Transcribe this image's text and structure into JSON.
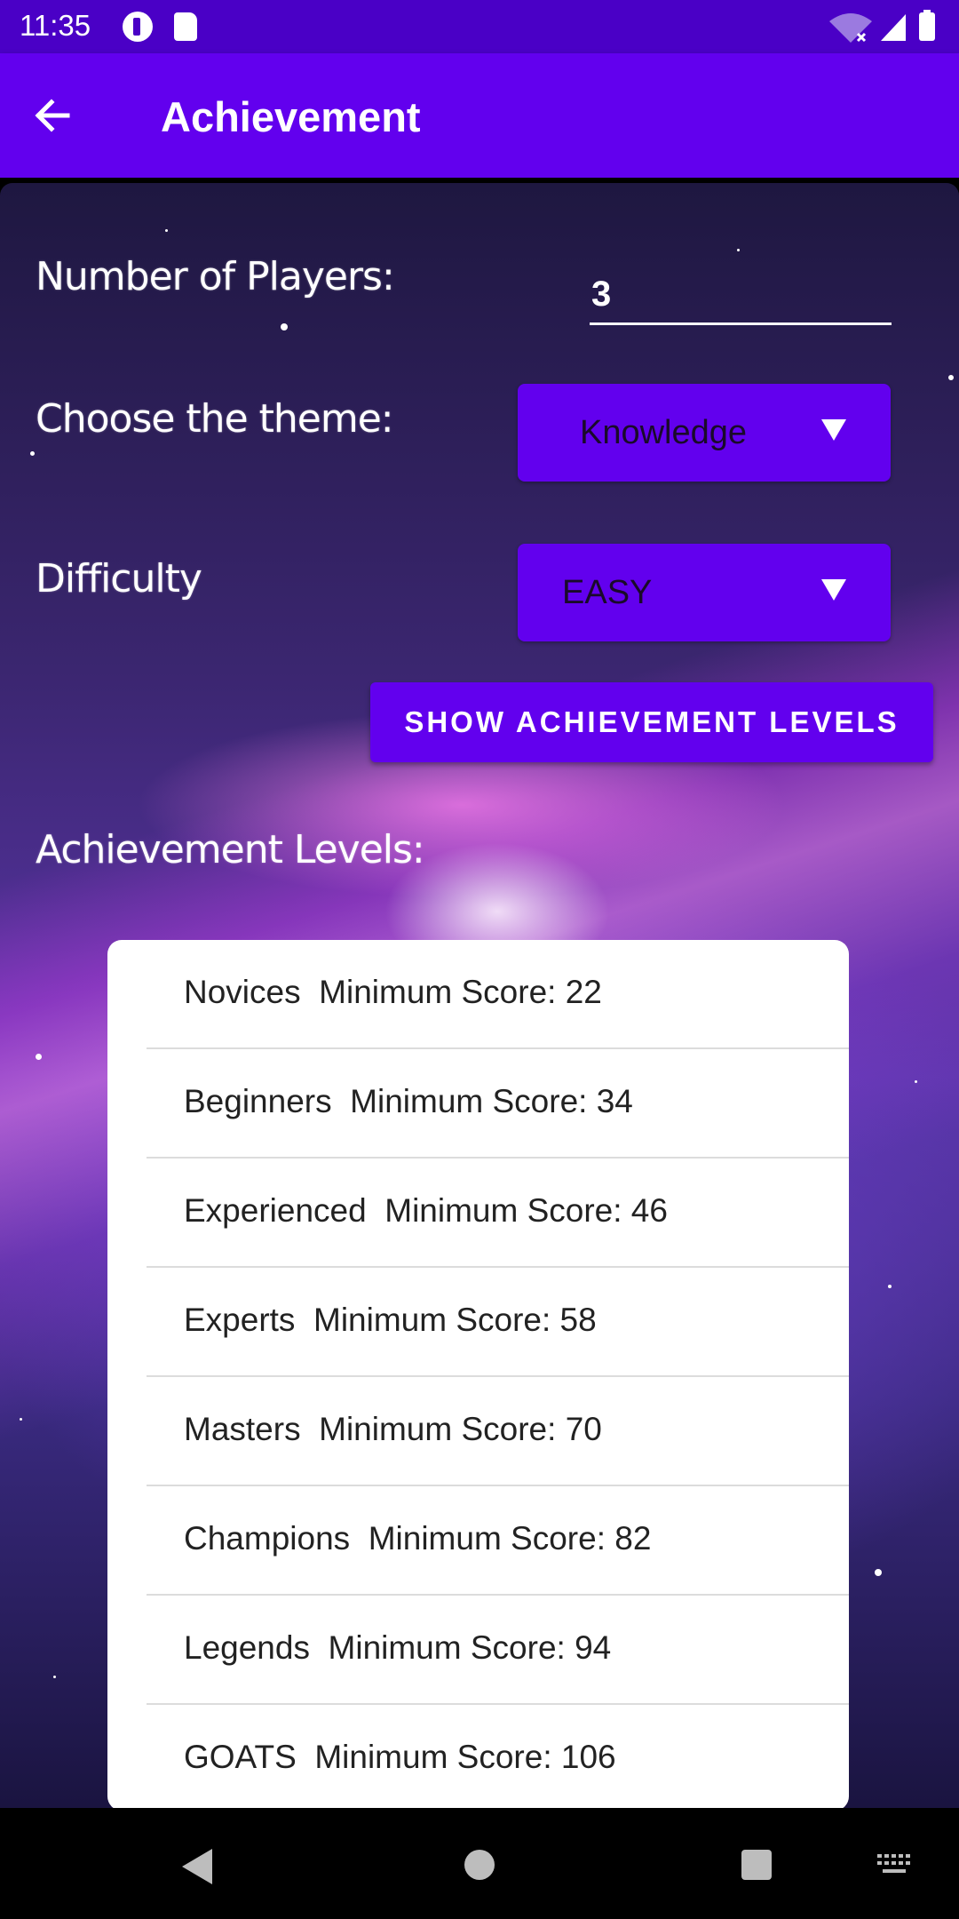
{
  "status_bar": {
    "time": "11:35"
  },
  "app_bar": {
    "title": "Achievement"
  },
  "form": {
    "players_label": "Number of Players:",
    "players_value": "3",
    "theme_label": "Choose the theme:",
    "theme_value": "Knowledge",
    "difficulty_label": "Difficulty",
    "difficulty_value": "EASY",
    "show_button": "SHOW ACHIEVEMENT LEVELS",
    "levels_label": "Achievement Levels:"
  },
  "levels": [
    "Novices  Minimum Score: 22",
    "Beginners  Minimum Score: 34",
    "Experienced  Minimum Score: 46",
    "Experts  Minimum Score: 58",
    "Masters  Minimum Score: 70",
    "Champions  Minimum Score: 82",
    "Legends  Minimum Score: 94",
    "GOATS  Minimum Score: 106"
  ],
  "colors": {
    "primary": "#6200ee",
    "status_bar": "#4a00c6"
  },
  "icons": [
    "arrow-back-icon",
    "dropdown-arrow-icon",
    "nav-back-icon",
    "nav-home-icon",
    "nav-recents-icon",
    "keyboard-icon"
  ]
}
